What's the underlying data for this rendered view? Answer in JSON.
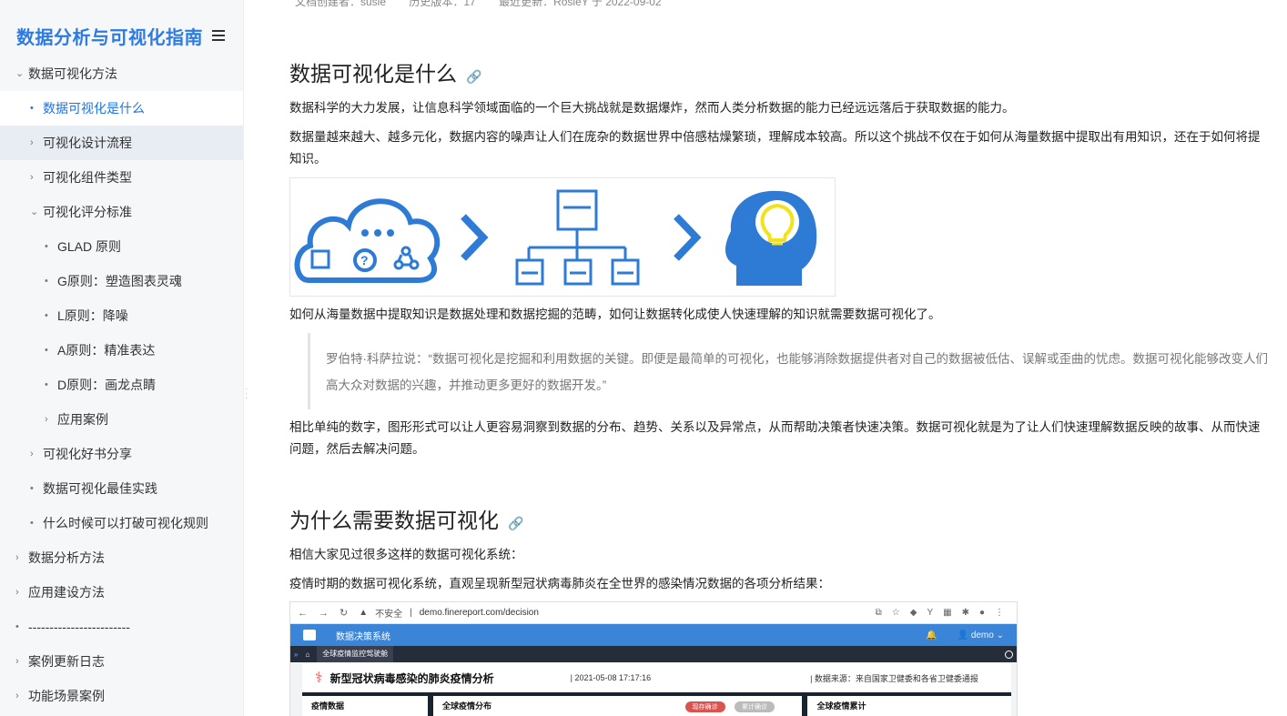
{
  "sidebar": {
    "title": "数据分析与可视化指南",
    "items": [
      {
        "label": "数据可视化方法",
        "marker": "⌄"
      },
      {
        "label": "数据可视化是什么",
        "marker": "•"
      },
      {
        "label": "可视化设计流程",
        "marker": "›"
      },
      {
        "label": "可视化组件类型",
        "marker": "›"
      },
      {
        "label": "可视化评分标准",
        "marker": "⌄"
      },
      {
        "label": "GLAD 原则",
        "marker": "•"
      },
      {
        "label": "G原则：塑造图表灵魂",
        "marker": "•"
      },
      {
        "label": "L原则：降噪",
        "marker": "•"
      },
      {
        "label": "A原则：精准表达",
        "marker": "•"
      },
      {
        "label": "D原则：画龙点睛",
        "marker": "•"
      },
      {
        "label": "应用案例",
        "marker": "›"
      },
      {
        "label": "可视化好书分享",
        "marker": "›"
      },
      {
        "label": "数据可视化最佳实践",
        "marker": "•"
      },
      {
        "label": "什么时候可以打破可视化规则",
        "marker": "•"
      },
      {
        "label": "数据分析方法",
        "marker": "›"
      },
      {
        "label": "应用建设方法",
        "marker": "›"
      },
      {
        "label": "------------------------",
        "marker": "•"
      },
      {
        "label": "案例更新日志",
        "marker": "›"
      },
      {
        "label": "功能场景案例",
        "marker": "›"
      }
    ]
  },
  "meta": {
    "creator": "文档创建者：susie",
    "version": "历史版本：17",
    "updated": "最近更新：RosieY 于 2022-09-02"
  },
  "content": {
    "h1": "数据可视化是什么",
    "p1": "数据科学的大力发展，让信息科学领域面临的一个巨大挑战就是数据爆炸，然而人类分析数据的能力已经远远落后于获取数据的能力。",
    "p2a": "数据量越来越大、越多元化，数据内容的噪声让人们在庞杂的数据世界中倍感枯燥繁琐，理解成本较高。所以这个挑战不仅在于如何从海量数据中提取出有用知识，还在于如何将提",
    "p2b": "知识。",
    "p3": "如何从海量数据中提取知识是数据处理和数据挖掘的范畴，如何让数据转化成使人快速理解的知识就需要数据可视化了。",
    "quote_a": "罗伯特·科萨拉说：“数据可视化是挖掘和利用数据的关键。即便是最简单的可视化，也能够消除数据提供者对自己的数据被低估、误解或歪曲的忧虑。数据可视化能够改变人们",
    "quote_b": "高大众对数据的兴趣，并推动更多更好的数据开发。”",
    "p4a": "相比单纯的数字，图形形式可以让人更容易洞察到数据的分布、趋势、关系以及异常点，从而帮助决策者快速决策。数据可视化就是为了让人们快速理解数据反映的故事、从而快速",
    "p4b": "问题，然后去解决问题。",
    "h2": "为什么需要数据可视化",
    "p5": "相信大家见过很多这样的数据可视化系统：",
    "p6": "疫情时期的数据可视化系统，直观呈现新型冠状病毒肺炎在全世界的感染情况数据的各项分析结果："
  },
  "screenshot": {
    "insecure": "不安全",
    "url": "demo.finereport.com/decision",
    "app_title": "数据决策系统",
    "user": "demo",
    "tab": "全球疫情监控驾驶舱",
    "dash_title": "新型冠状病毒感染的肺炎疫情分析",
    "datetime": "| 2021-05-08 17:17:16",
    "source": "| 数据来源：来自国家卫健委和各省卫健委通报",
    "panel1": "疫情数据",
    "panel2": "全球疫情分布",
    "btn1": "现存确诊",
    "btn2": "累计确诊",
    "panel3": "全球疫情累计"
  },
  "colors": {
    "accent": "#1e73e8",
    "diagram": "#2e7bd6",
    "bulb": "#f2e21a"
  }
}
